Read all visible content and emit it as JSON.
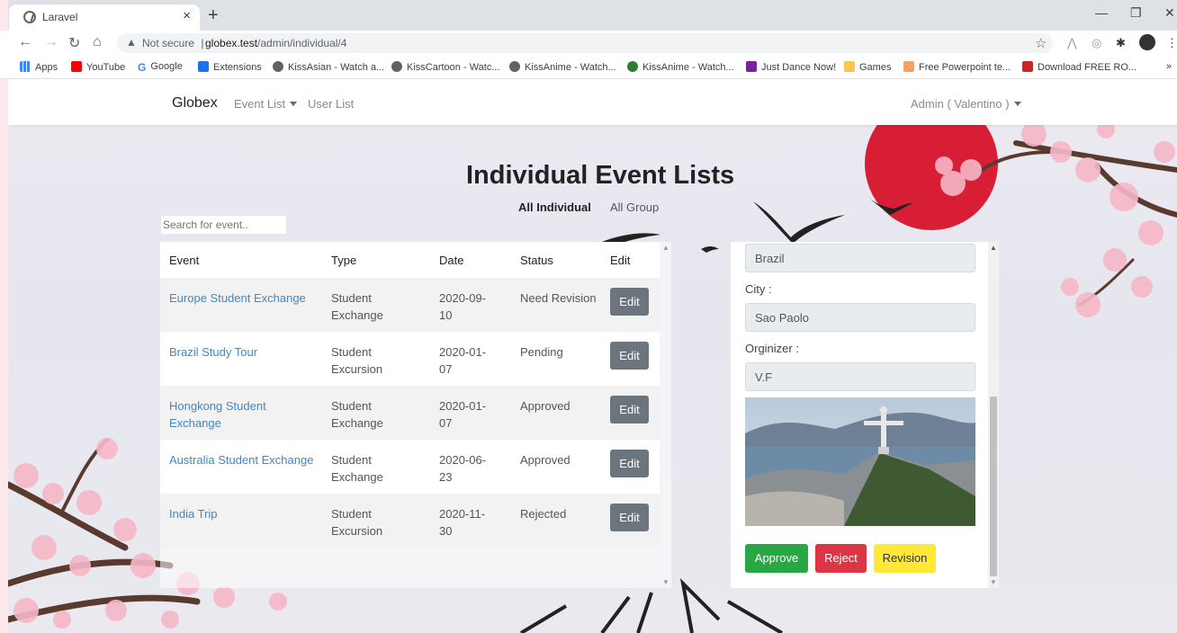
{
  "browser": {
    "tab_title": "Laravel",
    "tab_close": "×",
    "new_tab": "+",
    "address": {
      "security": "Not secure",
      "separator": "|",
      "host": "globex.test",
      "path": "/admin/individual/4"
    },
    "bookmarks": [
      {
        "label": "Apps",
        "color": "#4285f4"
      },
      {
        "label": "YouTube",
        "color": "#ff0000"
      },
      {
        "label": "Google",
        "color": "#4285f4"
      },
      {
        "label": "Extensions",
        "color": "#1a73e8"
      },
      {
        "label": "KissAsian - Watch a...",
        "color": "#5f6368"
      },
      {
        "label": "KissCartoon - Watc...",
        "color": "#5f6368"
      },
      {
        "label": "KissAnime - Watch...",
        "color": "#5f6368"
      },
      {
        "label": "KissAnime - Watch...",
        "color": "#2e7d32"
      },
      {
        "label": "Just Dance Now!",
        "color": "#7b1fa2"
      },
      {
        "label": "Games",
        "color": "#f9c74f"
      },
      {
        "label": "Free Powerpoint te...",
        "color": "#f4a261"
      },
      {
        "label": "Download FREE RO...",
        "color": "#c62828"
      }
    ],
    "more_bookmarks": "»"
  },
  "nav": {
    "brand": "Globex",
    "event_list": "Event List",
    "user_list": "User List",
    "user": "Admin ( Valentino )"
  },
  "main": {
    "title": "Individual Event Lists",
    "tabs": [
      "All Individual",
      "All Group"
    ],
    "search_placeholder": "Search for event..",
    "columns": [
      "Event",
      "Type",
      "Date",
      "Status",
      "Edit"
    ],
    "rows": [
      {
        "event": "Europe Student Exchange",
        "type": "Student Exchange",
        "date": "2020-09-10",
        "status": "Need Revision",
        "edit": "Edit"
      },
      {
        "event": "Brazil Study Tour",
        "type": "Student Excursion",
        "date": "2020-01-07",
        "status": "Pending",
        "edit": "Edit"
      },
      {
        "event": "Hongkong Student Exchange",
        "type": "Student Exchange",
        "date": "2020-01-07",
        "status": "Approved",
        "edit": "Edit"
      },
      {
        "event": "Australia Student Exchange",
        "type": "Student Exchange",
        "date": "2020-06-23",
        "status": "Approved",
        "edit": "Edit"
      },
      {
        "event": "India Trip",
        "type": "Student Excursion",
        "date": "2020-11-30",
        "status": "Rejected",
        "edit": "Edit"
      }
    ]
  },
  "detail": {
    "country": "Brazil",
    "city_label": "City :",
    "city": "Sao Paolo",
    "organizer_label": "Orginizer :",
    "organizer": "V.F",
    "approve": "Approve",
    "reject": "Reject",
    "revision": "Revision"
  },
  "colors": {
    "approve": "#28a745",
    "reject": "#dc3545",
    "revision": "#ffe936",
    "link": "#3f88c5",
    "edit_button": "#6c757d",
    "sun": "#d81e35"
  }
}
